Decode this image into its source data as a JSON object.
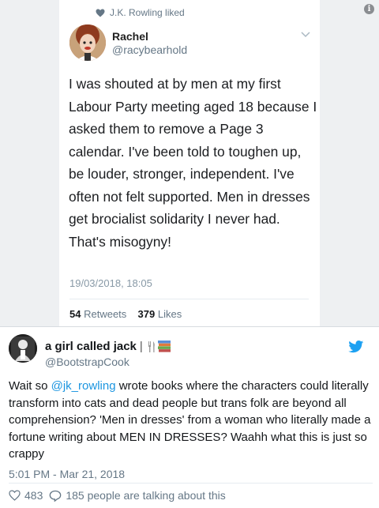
{
  "embedded_tweet": {
    "liked_by": "J.K. Rowling liked",
    "author_name": "Rachel",
    "author_handle": "@racybearhold",
    "text": "I was shouted at by men at my first Labour Party meeting aged 18 because I asked them to remove a Page 3 calendar. I've been told to toughen up, be louder, stronger, independent. I've often not felt supported. Men in dresses get brocialist solidarity I never had. That's misogyny!",
    "timestamp": "19/03/2018, 18:05",
    "retweets_count": "54",
    "retweets_label": "Retweets",
    "likes_count": "379",
    "likes_label": "Likes"
  },
  "main_tweet": {
    "author_name": "a girl called jack",
    "name_separator": "|",
    "author_handle": "@BootstrapCook",
    "text_part1": "Wait so ",
    "mention": "@jk_rowling",
    "text_part2": " wrote books where the characters could literally transform into cats and dead people but trans folk are beyond all comprehension? 'Men in dresses' from a woman who literally made a fortune writing about MEN IN DRESSES? Waahh what this is just so crappy",
    "timestamp": "5:01 PM - Mar 21, 2018",
    "likes_count": "483",
    "talking_text": "185 people are talking about this"
  },
  "colors": {
    "link": "#1b95e0",
    "twitter_bird": "#1da1f2",
    "heart_liked": "#657786",
    "secondary_text": "#657786"
  },
  "icons": [
    "heart-icon",
    "chevron-down-icon",
    "info-icon",
    "twitter-bird-icon",
    "fork-knife-icon",
    "books-icon",
    "like-heart-icon",
    "reply-bubble-icon"
  ]
}
